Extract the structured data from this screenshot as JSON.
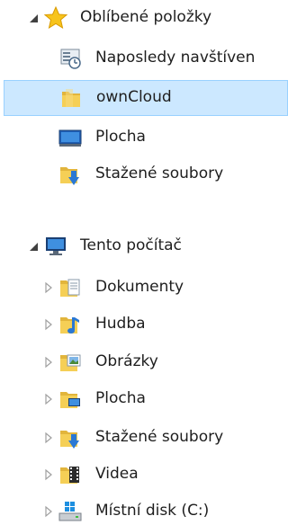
{
  "favorites": {
    "label": "Oblíbené položky",
    "items": [
      {
        "label": "Naposledy navštíven",
        "icon": "recent-places-icon"
      },
      {
        "label": "ownCloud",
        "icon": "folder-icon",
        "selected": true
      },
      {
        "label": "Plocha",
        "icon": "desktop-icon"
      },
      {
        "label": "Stažené soubory",
        "icon": "downloads-folder-icon"
      }
    ]
  },
  "this_pc": {
    "label": "Tento počítač",
    "items": [
      {
        "label": "Dokumenty",
        "icon": "documents-folder-icon"
      },
      {
        "label": "Hudba",
        "icon": "music-folder-icon"
      },
      {
        "label": "Obrázky",
        "icon": "pictures-folder-icon"
      },
      {
        "label": "Plocha",
        "icon": "desktop-folder-icon"
      },
      {
        "label": "Stažené soubory",
        "icon": "downloads-folder-icon"
      },
      {
        "label": "Videa",
        "icon": "videos-folder-icon"
      },
      {
        "label": "Místní disk (C:)",
        "icon": "local-disk-icon"
      }
    ]
  },
  "colors": {
    "selection_bg": "#cce8ff",
    "selection_border": "#99d1ff",
    "folder_yellow": "#f5cf56",
    "arrow_gray": "#a0a0a0",
    "arrow_dark": "#404040",
    "star_gold": "#f7c41c"
  }
}
